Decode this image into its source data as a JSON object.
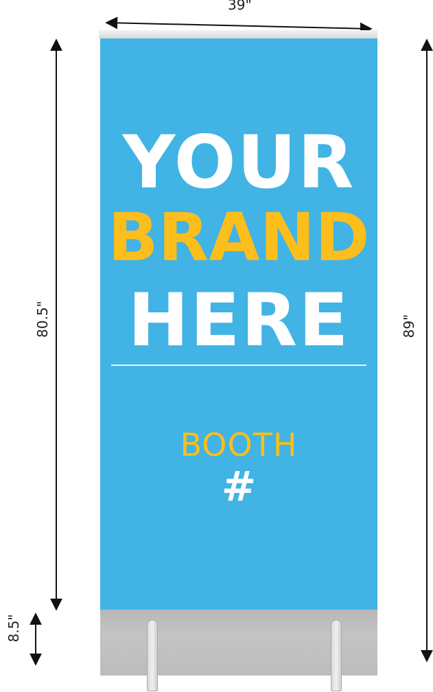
{
  "dimensions": {
    "width": "39\"",
    "banner_height": "80.5\"",
    "total_height": "89\"",
    "base_height": "8.5\""
  },
  "banner": {
    "line1": "YOUR",
    "line2": "BRAND",
    "line3": "HERE",
    "booth_label": "BOOTH",
    "booth_number": "#"
  },
  "colors": {
    "banner_background": "#41b3e4",
    "accent_yellow": "#fbbe1c",
    "text_white": "#ffffff",
    "base_gray": "#bdbdbd"
  }
}
